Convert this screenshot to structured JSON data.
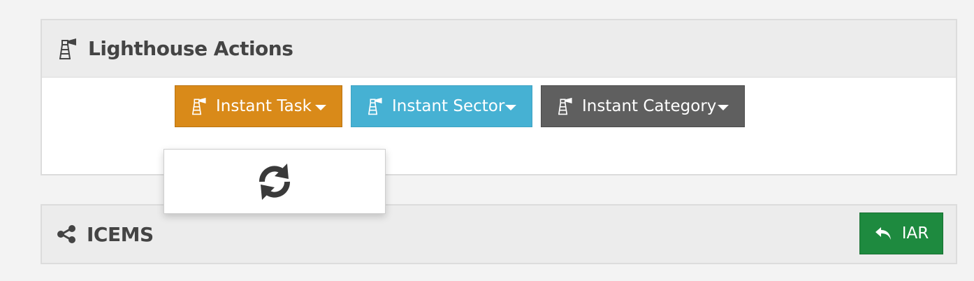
{
  "lighthouse_panel": {
    "title": "Lighthouse Actions",
    "icon": "lighthouse-icon",
    "buttons": [
      {
        "label": "Instant Task",
        "color": "#d98a19",
        "icon": "lighthouse-icon"
      },
      {
        "label": "Instant Sector",
        "color": "#46b1d3",
        "icon": "lighthouse-icon"
      },
      {
        "label": "Instant Category",
        "color": "#5f5f5f",
        "icon": "lighthouse-icon"
      }
    ],
    "dropdown": {
      "icon": "refresh-icon"
    }
  },
  "icems_panel": {
    "title": "ICEMS",
    "icon": "share-icon",
    "action_button": {
      "label": "IAR",
      "color": "#1e8a3f",
      "icon": "reply-icon"
    }
  }
}
